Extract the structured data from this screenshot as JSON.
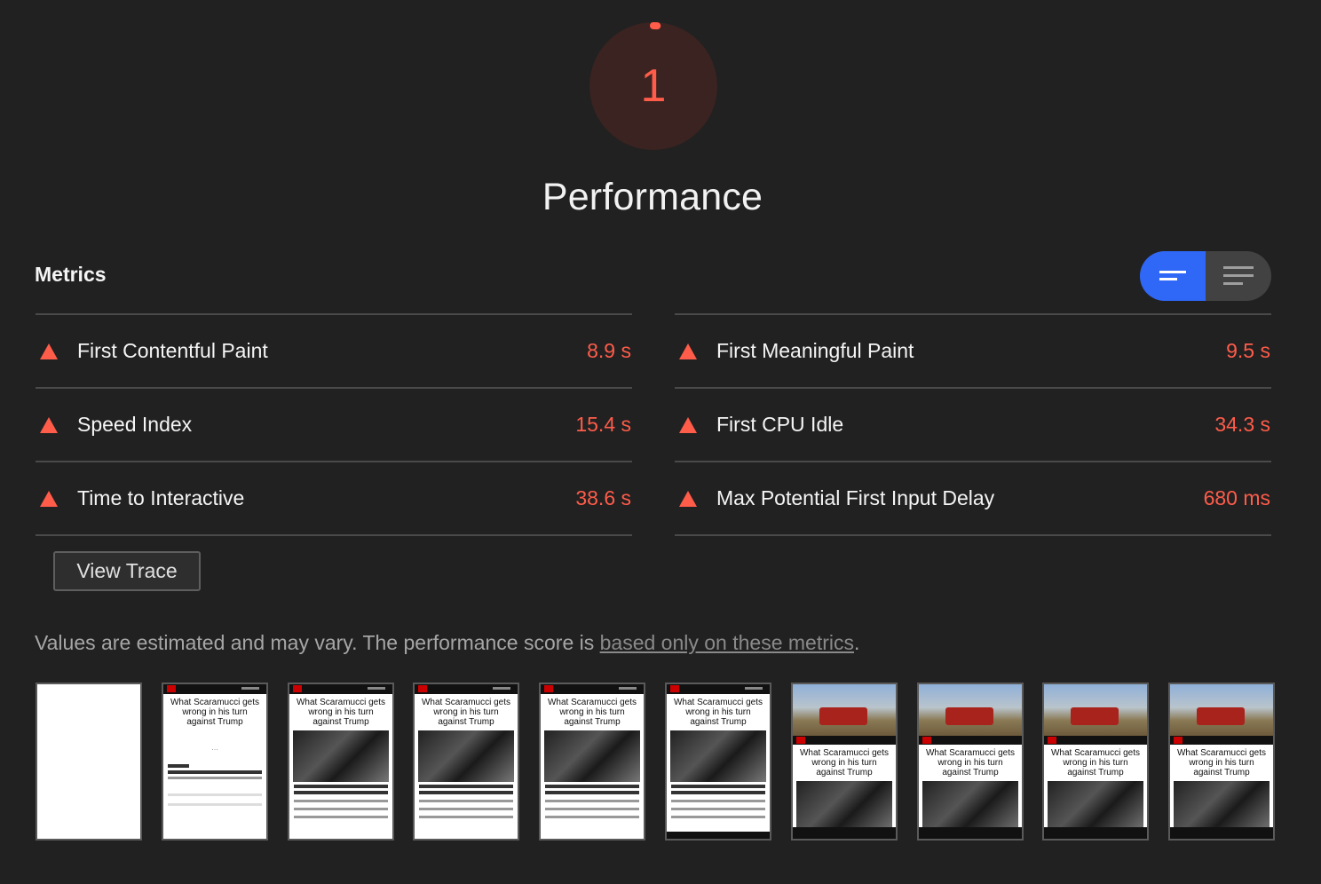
{
  "gauge": {
    "score": "1",
    "score_fraction": 0.01,
    "color": "#ff5c4a"
  },
  "category": {
    "title": "Performance"
  },
  "metrics": {
    "heading": "Metrics",
    "toggle": {
      "active": "summary",
      "icons": [
        "summary-view-icon",
        "detailed-view-icon"
      ]
    },
    "left": [
      {
        "label": "First Contentful Paint",
        "value": "8.9 s"
      },
      {
        "label": "Speed Index",
        "value": "15.4 s"
      },
      {
        "label": "Time to Interactive",
        "value": "38.6 s"
      }
    ],
    "right": [
      {
        "label": "First Meaningful Paint",
        "value": "9.5 s"
      },
      {
        "label": "First CPU Idle",
        "value": "34.3 s"
      },
      {
        "label": "Max Potential First Input Delay",
        "value": "680 ms"
      }
    ],
    "status_color": "#ff5c4a"
  },
  "view_trace": {
    "label": "View Trace"
  },
  "note": {
    "text_before": "Values are estimated and may vary. The performance score is ",
    "link": "based only on these metrics",
    "text_after": "."
  },
  "filmstrip": {
    "frames": [
      {
        "kind": "blank"
      },
      {
        "kind": "text-loading",
        "headline": "What Scaramucci gets wrong in his turn against Trump"
      },
      {
        "kind": "article",
        "headline": "What Scaramucci gets wrong in his turn against Trump"
      },
      {
        "kind": "article",
        "headline": "What Scaramucci gets wrong in his turn against Trump"
      },
      {
        "kind": "article",
        "headline": "What Scaramucci gets wrong in his turn against Trump"
      },
      {
        "kind": "article",
        "headline": "What Scaramucci gets wrong in his turn against Trump"
      },
      {
        "kind": "ad",
        "headline": "What Scaramucci gets wrong in his turn against Trump"
      },
      {
        "kind": "ad",
        "headline": "What Scaramucci gets wrong in his turn against Trump"
      },
      {
        "kind": "ad",
        "headline": "What Scaramucci gets wrong in his turn against Trump"
      },
      {
        "kind": "ad",
        "headline": "What Scaramucci gets wrong in his turn against Trump"
      }
    ]
  }
}
